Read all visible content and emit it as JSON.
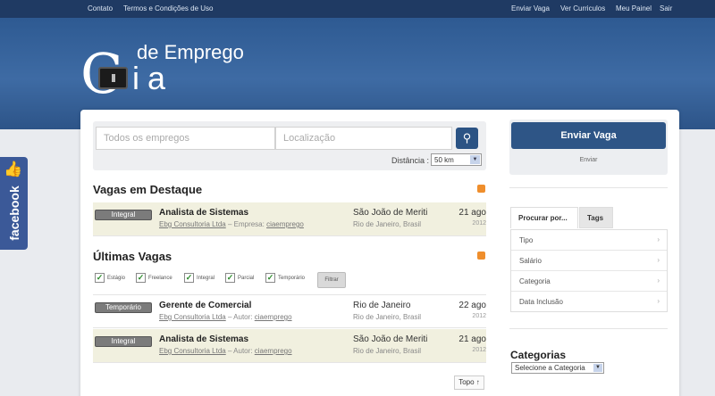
{
  "topbar": {
    "left": [
      "Contato",
      "Termos e Condições de Uso"
    ],
    "right": [
      "Enviar Vaga",
      "Ver Curriculos",
      "Meu Painel",
      "Sair"
    ]
  },
  "logo": {
    "c": "C",
    "ia": "ia",
    "sub": "de Emprego"
  },
  "search": {
    "jobs_placeholder": "Todos os empregos",
    "location_placeholder": "Localização",
    "distance_label": "Distância :",
    "distance_value": "50 km"
  },
  "featured": {
    "title": "Vagas em Destaque",
    "jobs": [
      {
        "type": "Integral",
        "title": "Analista de Sistemas",
        "company": "Ebg Consultoria Ltda",
        "sep": " – Empresa: ",
        "poster": "ciaemprego",
        "city": "São João de Meriti",
        "region": "Rio de Janeiro, Brasil",
        "date": "21 ago",
        "year": "2012"
      }
    ]
  },
  "latest": {
    "title": "Últimas Vagas",
    "filters": [
      "Estágio",
      "Freelance",
      "Integral",
      "Parcial",
      "Temporário"
    ],
    "filter_button": "Filtrar",
    "jobs": [
      {
        "type": "Temporário",
        "title": "Gerente de Comercial",
        "company": "Ebg Consultoria Ltda",
        "sep": " – Autor: ",
        "poster": "ciaemprego",
        "city": "Rio de Janeiro",
        "region": "Rio de Janeiro, Brasil",
        "date": "22 ago",
        "year": "2012"
      },
      {
        "type": "Integral",
        "title": "Analista de Sistemas",
        "company": "Ebg Consultoria Ltda",
        "sep": " – Autor: ",
        "poster": "ciaemprego",
        "city": "São João de Meriti",
        "region": "Rio de Janeiro, Brasil",
        "date": "21 ago",
        "year": "2012"
      }
    ],
    "top_link": "Topo ↑"
  },
  "sidebar": {
    "post_button": "Enviar Vaga",
    "post_sub": "Enviar",
    "tabs": [
      "Procurar por...",
      "Tags"
    ],
    "browse": [
      "Tipo",
      "Salário",
      "Categoria",
      "Data Inclusão"
    ],
    "categories_title": "Categorias",
    "category_select": "Selecione a Categoria"
  },
  "facebook": {
    "label": "facebook"
  }
}
